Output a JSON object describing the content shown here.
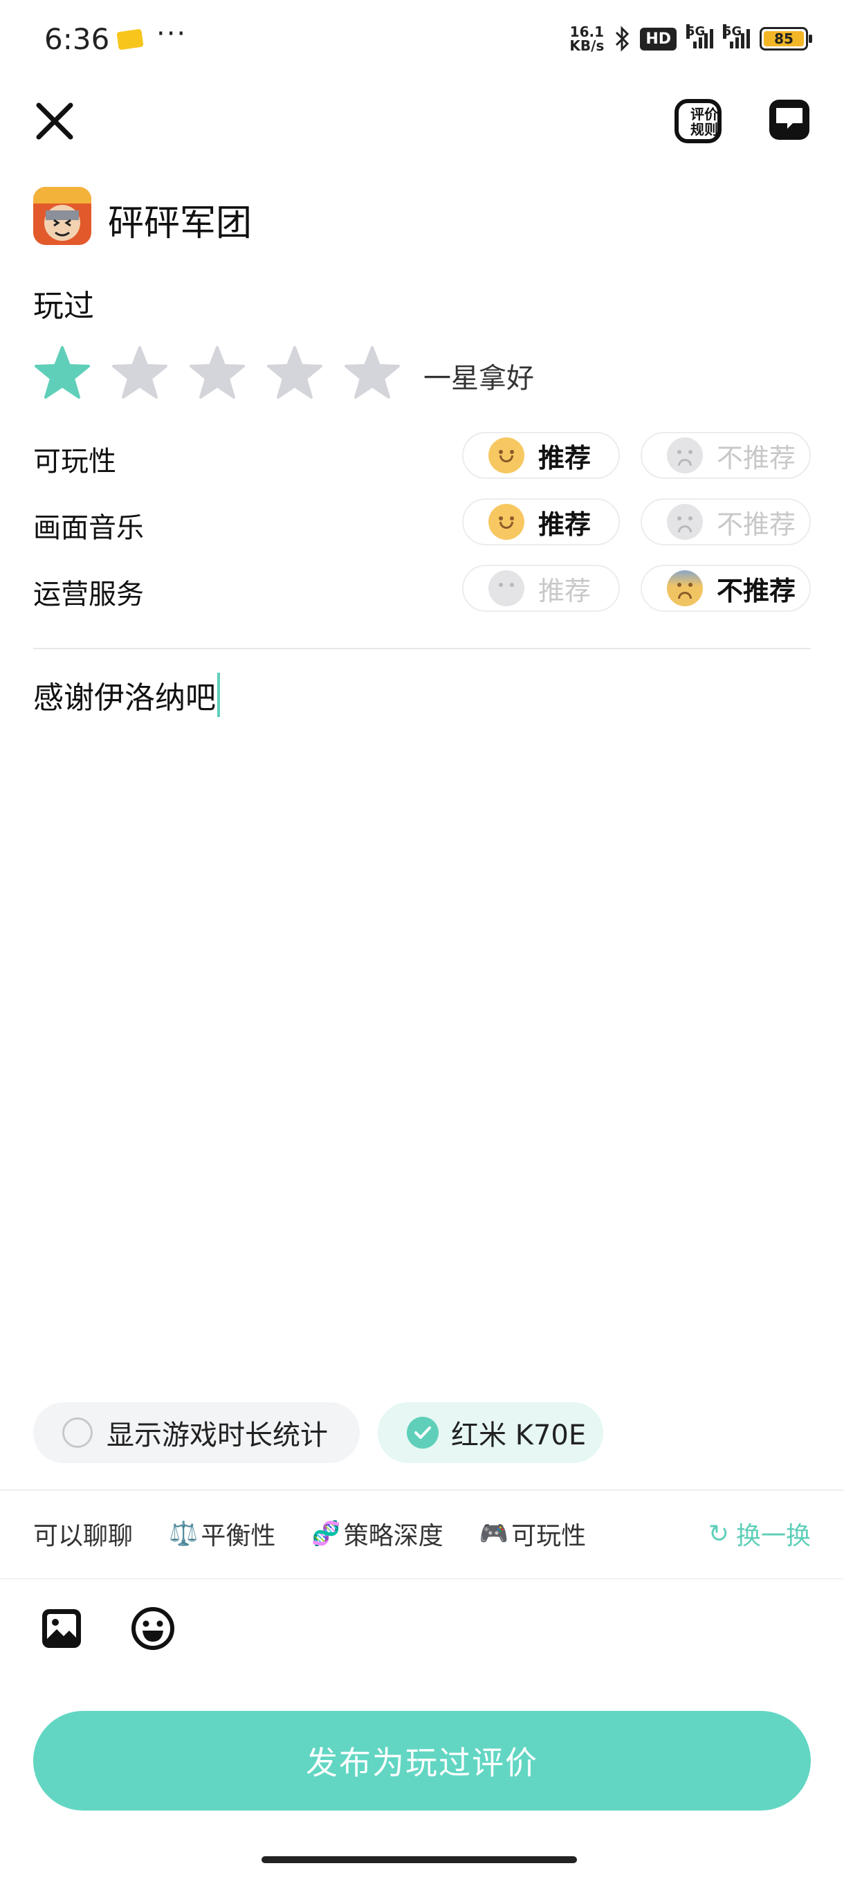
{
  "status_bar": {
    "time": "6:36",
    "dots": "···",
    "net_speed_value": "16.1",
    "net_speed_unit": "KB/s",
    "hd_label": "HD",
    "network_1": "5G",
    "network_2": "5G",
    "battery": "85"
  },
  "header": {
    "rules_label_1": "评价",
    "rules_label_2": "规则"
  },
  "game": {
    "title": "砰砰军团"
  },
  "review": {
    "section_title": "玩过",
    "rating": 1,
    "max_rating": 5,
    "rating_label": "一星拿好",
    "rows": [
      {
        "label": "可玩性",
        "recommend": "推荐",
        "not_recommend": "不推荐",
        "selected": "recommend"
      },
      {
        "label": "画面音乐",
        "recommend": "推荐",
        "not_recommend": "不推荐",
        "selected": "recommend"
      },
      {
        "label": "运营服务",
        "recommend": "推荐",
        "not_recommend": "不推荐",
        "selected": "not_recommend"
      }
    ],
    "text": "感谢伊洛纳吧"
  },
  "options": {
    "playtime_label": "显示游戏时长统计",
    "playtime_checked": false,
    "device_label": "红米 K70E",
    "device_checked": true
  },
  "topics": {
    "items": [
      {
        "icon": "",
        "label": "可以聊聊"
      },
      {
        "icon": "⚖️",
        "label": "平衡性"
      },
      {
        "icon": "🧬",
        "label": "策略深度"
      },
      {
        "icon": "🎮",
        "label": "可玩性"
      }
    ],
    "refresh_icon": "↻",
    "refresh_label": "换一换"
  },
  "footer": {
    "publish_label": "发布为玩过评价"
  },
  "colors": {
    "accent": "#5fcfb9",
    "publish_bg": "#62d6c3",
    "star_off": "#d4d5da"
  }
}
